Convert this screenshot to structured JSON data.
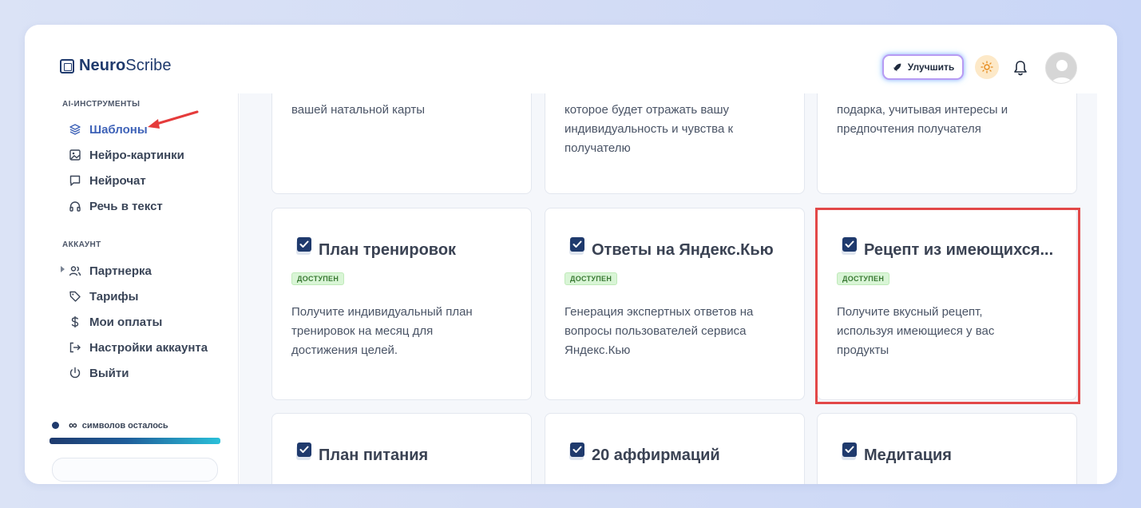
{
  "brand": {
    "name_bold": "Neuro",
    "name_regular": "Scribe"
  },
  "header": {
    "upgrade_label": "Улучшить"
  },
  "sidebar": {
    "section_tools": "AI-ИНСТРУМЕНТЫ",
    "tools": [
      {
        "label": "Шаблоны",
        "icon": "layers-icon",
        "active": true
      },
      {
        "label": "Нейро-картинки",
        "icon": "image-icon"
      },
      {
        "label": "Нейрочат",
        "icon": "chat-icon"
      },
      {
        "label": "Речь в текст",
        "icon": "headphones-icon"
      }
    ],
    "section_account": "АККАУНТ",
    "account": [
      {
        "label": "Партнерка",
        "icon": "users-icon"
      },
      {
        "label": "Тарифы",
        "icon": "tag-icon"
      },
      {
        "label": "Мои оплаты",
        "icon": "dollar-icon"
      },
      {
        "label": "Настройки аккаунта",
        "icon": "login-icon"
      },
      {
        "label": "Выйти",
        "icon": "power-icon"
      }
    ],
    "credits": {
      "symbol": "∞",
      "label": "символов осталось"
    }
  },
  "cards_top": [
    {
      "desc_lines": [
        "вашей натальной карты"
      ]
    },
    {
      "desc_lines": [
        "которое будет отражать вашу",
        "индивидуальность и чувства к",
        "получателю"
      ]
    },
    {
      "desc_lines": [
        "подарка, учитывая интересы и",
        "предпочтения получателя"
      ]
    }
  ],
  "cards_mid": [
    {
      "title": "План тренировок",
      "badge": "ДОСТУПЕН",
      "desc_lines": [
        "Получите индивидуальный план",
        "тренировок на месяц для",
        "достижения целей."
      ]
    },
    {
      "title": "Ответы на Яндекс.Кью",
      "badge": "ДОСТУПЕН",
      "desc_lines": [
        "Генерация экспертных ответов на",
        "вопросы пользователей сервиса",
        "Яндекс.Кью"
      ]
    },
    {
      "title": "Рецепт из имеющихся...",
      "badge": "ДОСТУПЕН",
      "desc_lines": [
        "Получите вкусный рецепт,",
        "используя имеющиеся у вас",
        "продукты"
      ]
    }
  ],
  "cards_bottom": [
    {
      "title": "План питания"
    },
    {
      "title": "20 аффирмаций"
    },
    {
      "title": "Медитация"
    }
  ]
}
